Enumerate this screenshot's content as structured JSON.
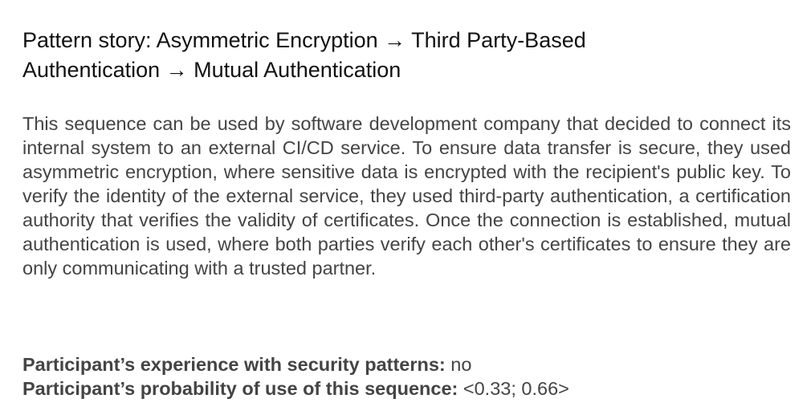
{
  "title": "Pattern story: Asymmetric Encryption → Third Party-Based Authentication → Mutual Authentication",
  "story": "This sequence can be used by software development company that decided to connect its internal system to an external CI/CD service. To ensure data transfer is secure, they used asymmetric encryption, where sensitive data is encrypted with the recipient's public key. To verify the identity of the external service, they used third-party authentication, a certification authority that verifies the validity of certificates. Once the connection is established, mutual authentication is used, where both parties verify each other's certificates to ensure they are only communicating with a trusted partner.",
  "experience": {
    "label": "Participant’s experience with security patterns:",
    "value": "no"
  },
  "probability": {
    "label": "Participant’s probability of use of this sequence:",
    "value": "<0.33; 0.66>"
  }
}
